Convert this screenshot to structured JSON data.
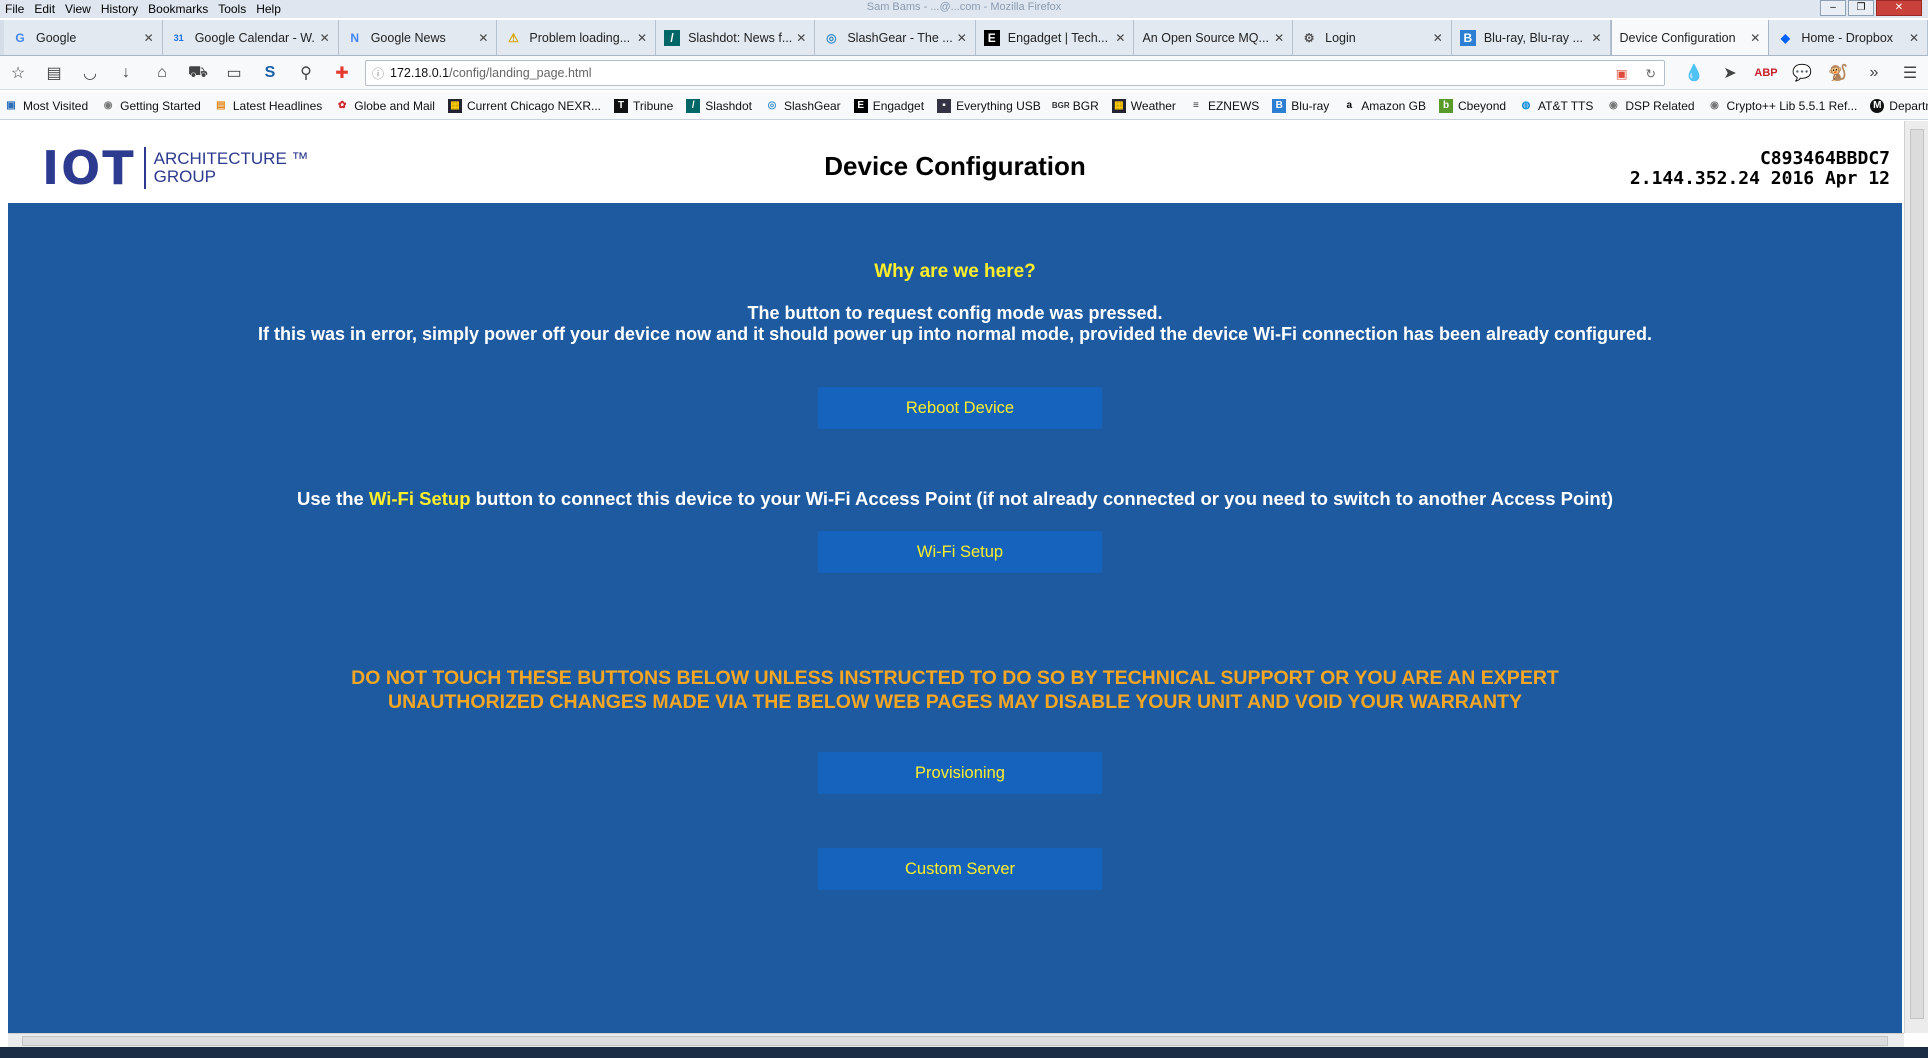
{
  "window": {
    "caption": "Sam Bams - ...@...com - Mozilla Firefox"
  },
  "menu": [
    "File",
    "Edit",
    "View",
    "History",
    "Bookmarks",
    "Tools",
    "Help"
  ],
  "tabs": [
    {
      "label": "Google",
      "icon": "G"
    },
    {
      "label": "Google Calendar - W...",
      "icon": "31"
    },
    {
      "label": "Google News",
      "icon": "N"
    },
    {
      "label": "Problem loading...",
      "icon": "⚠"
    },
    {
      "label": "Slashdot: News f...",
      "icon": "/"
    },
    {
      "label": "SlashGear - The ...",
      "icon": "◎"
    },
    {
      "label": "Engadget | Tech...",
      "icon": "E"
    },
    {
      "label": "An Open Source MQ...",
      "icon": ""
    },
    {
      "label": "Login",
      "icon": "⚙"
    },
    {
      "label": "Blu-ray, Blu-ray ...",
      "icon": "B"
    },
    {
      "label": "Device Configuration",
      "icon": ""
    },
    {
      "label": "Home - Dropbox",
      "icon": "◆"
    }
  ],
  "address": {
    "host": "172.18.0.1",
    "path": "/config/landing_page.html"
  },
  "bookmarks": [
    "Most Visited",
    "Getting Started",
    "Latest Headlines",
    "Globe and Mail",
    "Current Chicago NEXR...",
    "Tribune",
    "Slashdot",
    "SlashGear",
    "Engadget",
    "Everything USB",
    "BGR",
    "Weather",
    "EZNEWS",
    "Blu-ray",
    "Amazon GB",
    "Cbeyond",
    "AT&T TTS",
    "DSP Related",
    "Crypto++ Lib 5.5.1 Ref...",
    "Department-Parts Mot..."
  ],
  "page": {
    "logo_mark": "IOT",
    "logo_line1": "ARCHITECTURE ™",
    "logo_line2": "GROUP",
    "title": "Device Configuration",
    "device_id": "C893464BBDC7",
    "firmware": "2.144.352.24 2016 Apr 12",
    "why_heading": "Why are we here?",
    "explain_line1": "The button to request config mode was pressed.",
    "explain_line2": "If this was in error, simply power off your device now and it should power up into normal mode, provided the device Wi-Fi connection has been already configured.",
    "reboot_button": "Reboot Device",
    "wifi_pre": "Use the ",
    "wifi_highlight": "Wi-Fi Setup",
    "wifi_post": " button to connect this device to your Wi-Fi Access Point (if not already connected or you need to switch to another Access Point)",
    "wifi_button": "Wi-Fi Setup",
    "warning_line1": "DO NOT TOUCH THESE BUTTONS BELOW UNLESS INSTRUCTED TO DO SO BY TECHNICAL SUPPORT OR YOU ARE AN EXPERT",
    "warning_line2": "UNAUTHORIZED CHANGES MADE VIA THE BELOW WEB PAGES MAY DISABLE YOUR UNIT AND VOID YOUR WARRANTY",
    "provisioning_button": "Provisioning",
    "custom_server_button": "Custom Server"
  },
  "colors": {
    "page_bg": "#1e5aa0",
    "button_bg": "#1663bd",
    "highlight": "#ffef2a",
    "warning": "#f5a623"
  }
}
